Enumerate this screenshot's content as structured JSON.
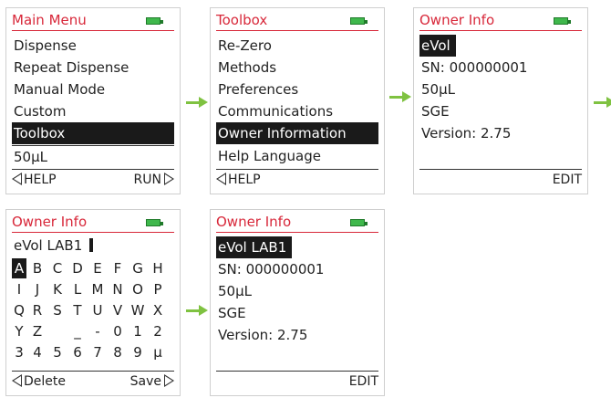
{
  "screens": {
    "main_menu": {
      "title": "Main Menu",
      "items": [
        "Dispense",
        "Repeat Dispense",
        "Manual Mode",
        "Custom",
        "Toolbox"
      ],
      "selected_index": 4,
      "volume": "50µL",
      "footer_left": "HELP",
      "footer_right": "RUN"
    },
    "toolbox": {
      "title": "Toolbox",
      "items": [
        "Re-Zero",
        "Methods",
        "Preferences",
        "Communications",
        "Owner Information",
        "Help Language"
      ],
      "selected_index": 4,
      "footer_left": "HELP"
    },
    "owner_info_1": {
      "title": "Owner Info",
      "name": "eVol",
      "serial": "SN: 000000001",
      "volume": "50µL",
      "maker": "SGE",
      "version": "Version: 2.75",
      "footer_right": "EDIT"
    },
    "owner_edit": {
      "title": "Owner Info",
      "entry": "eVol LAB1",
      "char_rows": [
        [
          "A",
          "B",
          "C",
          "D",
          "E",
          "F",
          "G",
          "H"
        ],
        [
          "I",
          "J",
          "K",
          "L",
          "M",
          "N",
          "O",
          "P"
        ],
        [
          "Q",
          "R",
          "S",
          "T",
          "U",
          "V",
          "W",
          "X"
        ],
        [
          "Y",
          "Z",
          "",
          "_",
          "-",
          "0",
          "1",
          "2"
        ],
        [
          "3",
          "4",
          "5",
          "6",
          "7",
          "8",
          "9",
          "µ"
        ]
      ],
      "selected_char": "A",
      "footer_left": "Delete",
      "footer_right": "Save"
    },
    "owner_info_2": {
      "title": "Owner Info",
      "name": "eVol LAB1",
      "serial": "SN: 000000001",
      "volume": "50µL",
      "maker": "SGE",
      "version": "Version: 2.75",
      "footer_right": "EDIT"
    }
  },
  "colors": {
    "title": "#d8283a",
    "arrow": "#7fc241",
    "battery": "#3fb84c",
    "selection": "#1a1a1a"
  },
  "icons": {
    "battery": "battery-icon",
    "flow_arrow": "right-arrow-icon",
    "softkey_left": "left-triangle-icon",
    "softkey_right": "right-triangle-icon"
  }
}
